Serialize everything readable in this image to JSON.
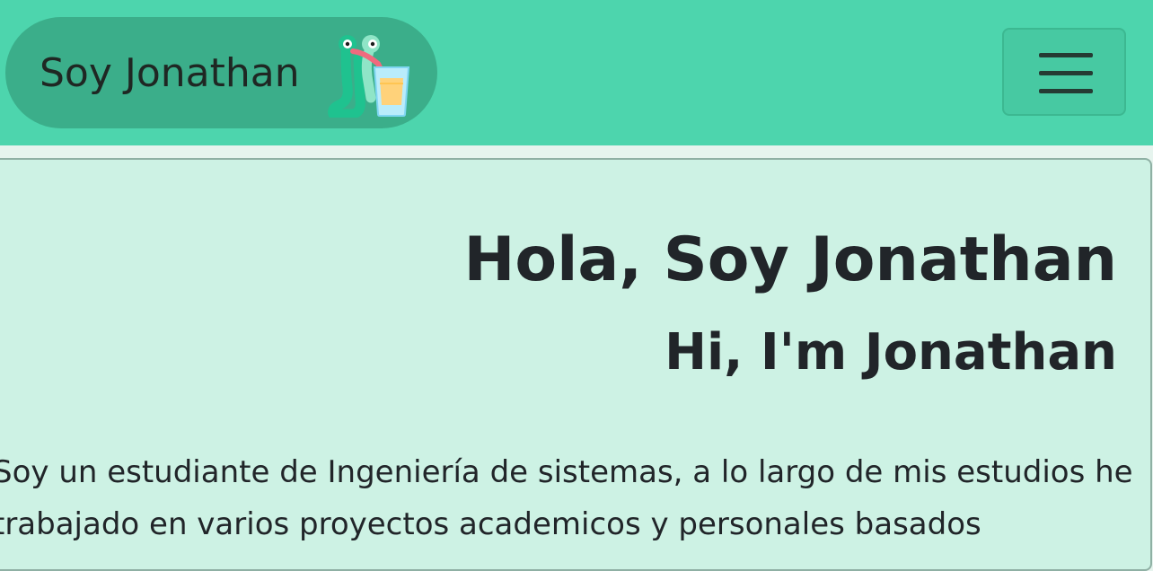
{
  "navbar": {
    "brand_text": "Soy Jonathan",
    "logo_icon": "worm-drinking-juice-icon",
    "toggler_icon": "hamburger-menu-icon"
  },
  "hero": {
    "title": "Hola, Soy Jonathan",
    "subtitle": "Hi, I'm Jonathan",
    "paragraph": "Soy un estudiante de Ingeniería de sistemas, a lo largo de mis estudios he trabajado en varios proyectos academicos y personales basados"
  },
  "colors": {
    "navbar_bg": "#4dd5ad",
    "brand_pill_bg": "#3bae8a",
    "card_bg": "#cdf2e4",
    "text": "#212529"
  }
}
